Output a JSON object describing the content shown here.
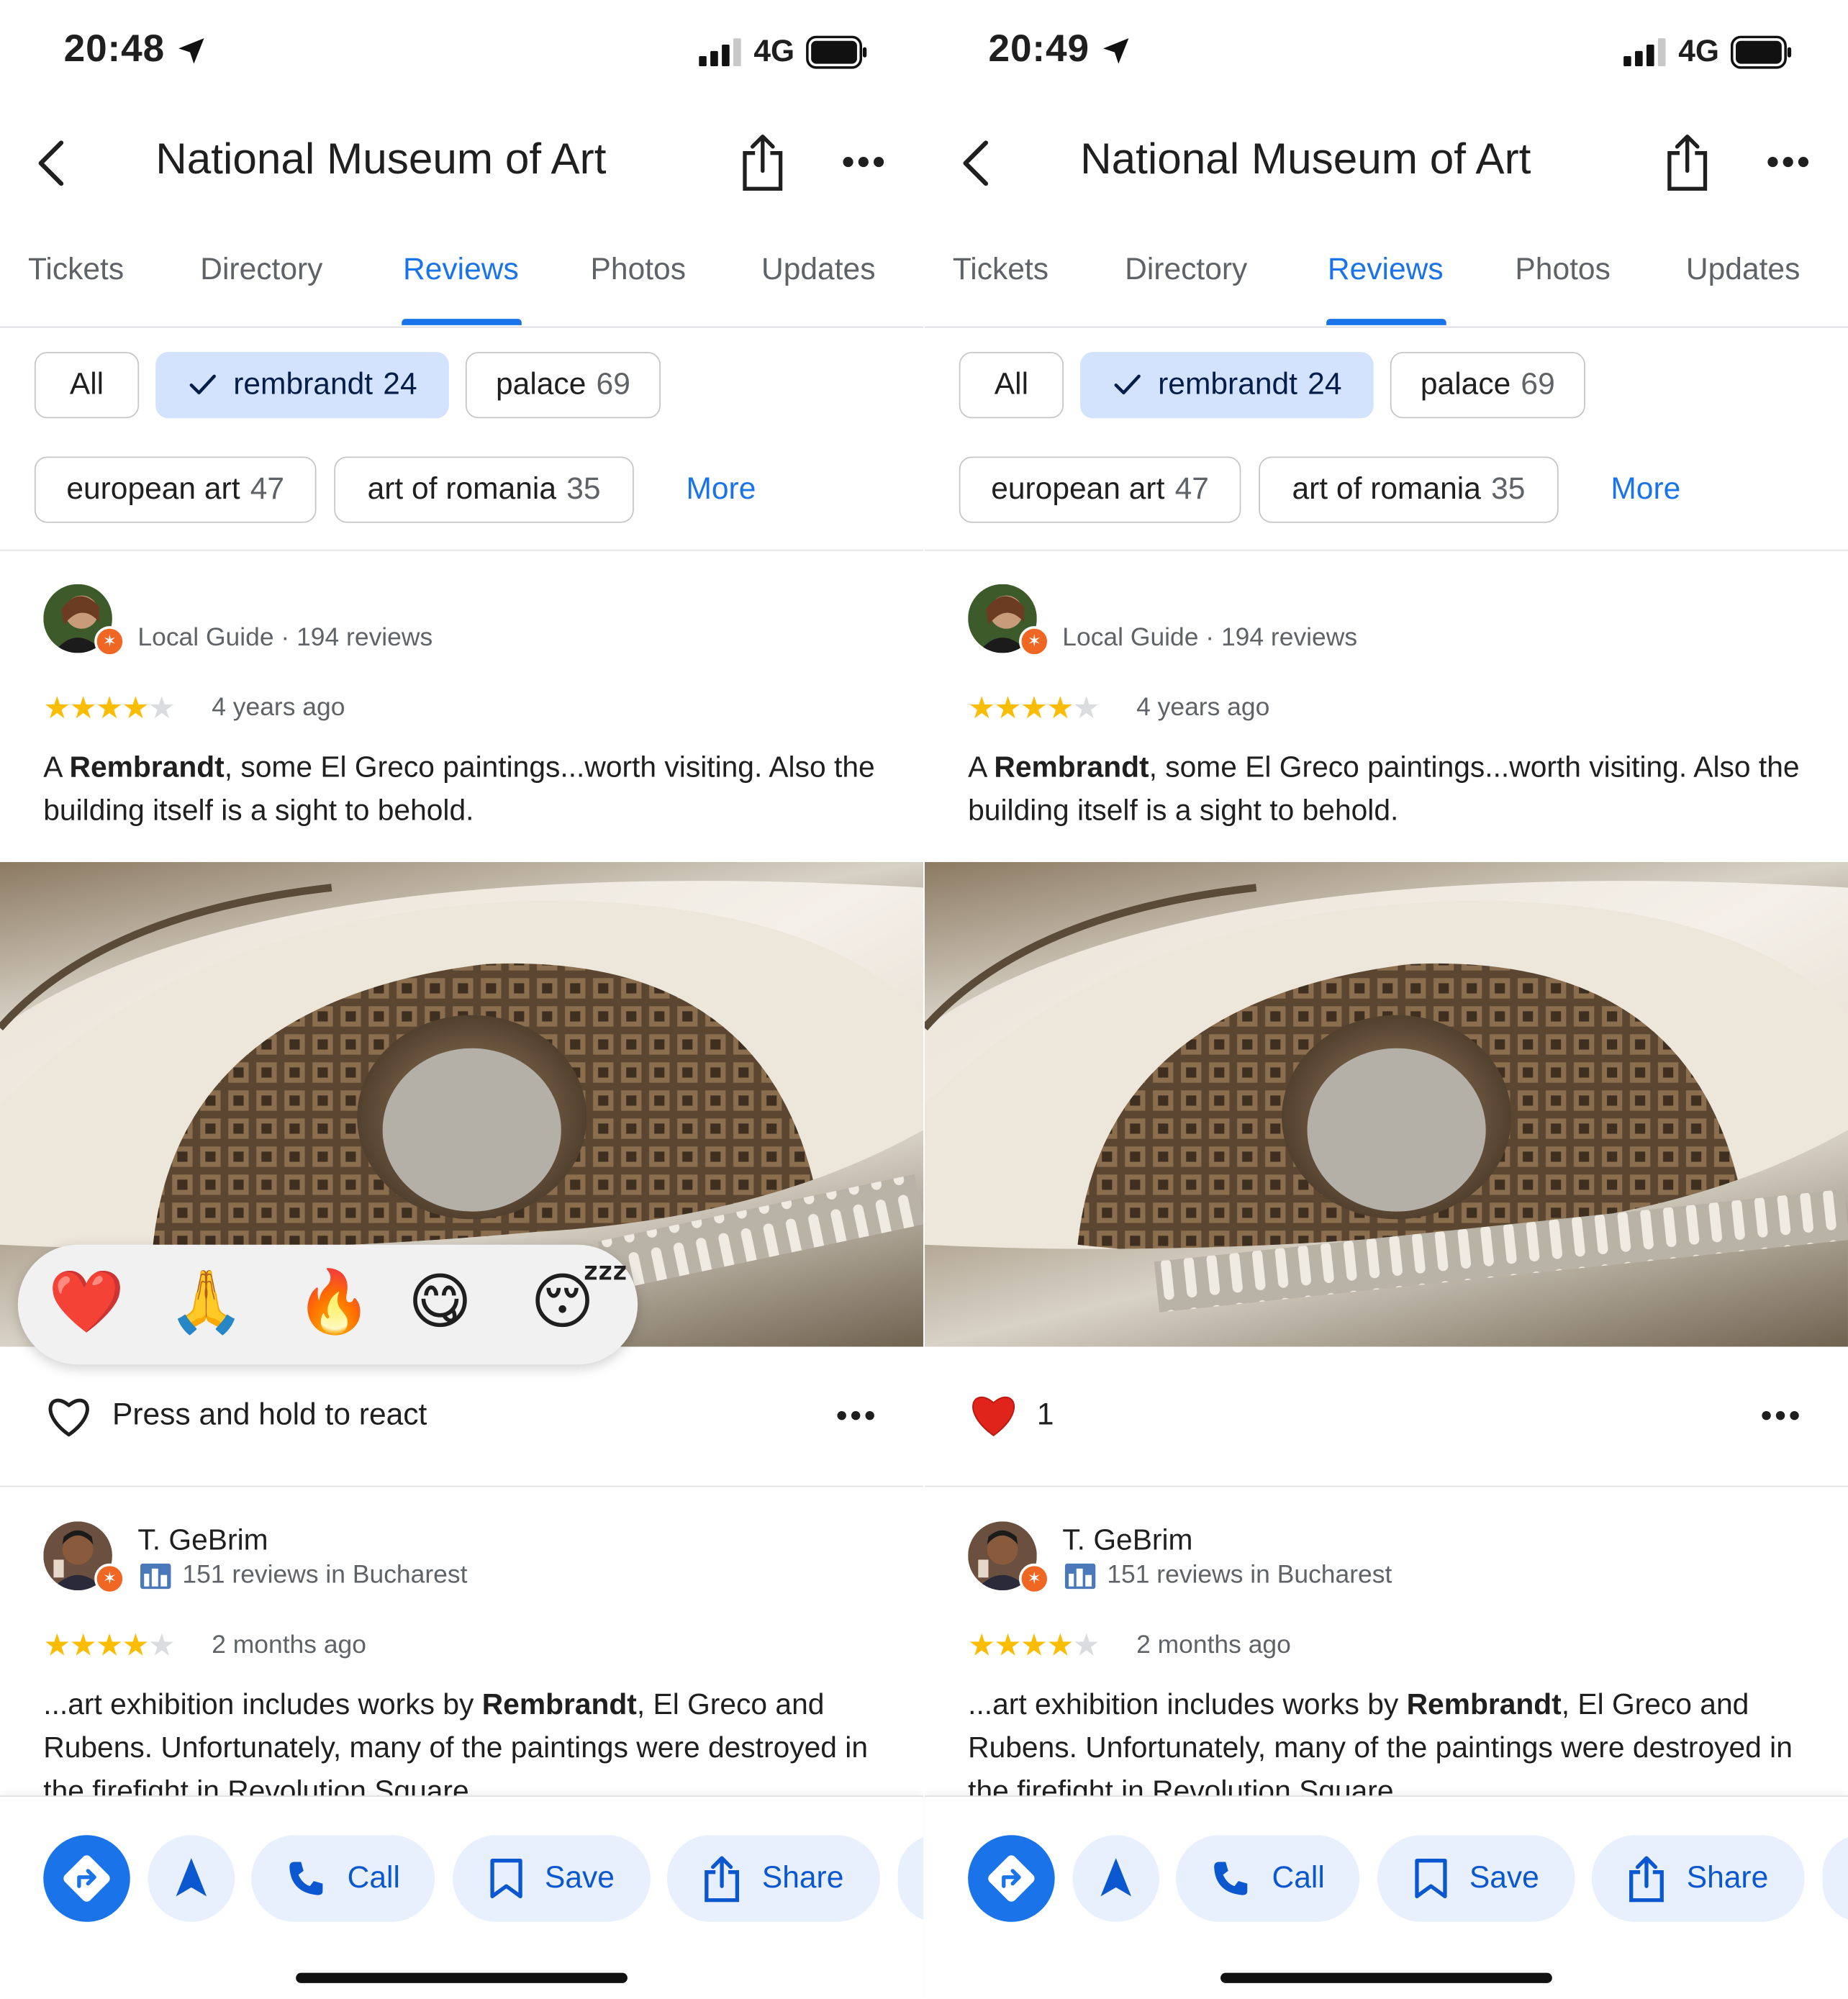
{
  "screens": [
    {
      "status": {
        "time": "20:48",
        "network": "4G"
      },
      "header": {
        "title": "National Museum of Art"
      },
      "tabs": [
        "Tickets",
        "Directory",
        "Reviews",
        "Photos",
        "Updates"
      ],
      "active_tab": "Reviews",
      "filters": [
        {
          "label": "All",
          "count": ""
        },
        {
          "label": "rembrandt",
          "count": "24",
          "selected": true
        },
        {
          "label": "palace",
          "count": "69"
        },
        {
          "label": "european art",
          "count": "47"
        },
        {
          "label": "art of romania",
          "count": "35"
        }
      ],
      "filters_more": "More",
      "review1": {
        "meta": "Local Guide · 194 reviews",
        "rating": 4,
        "time_ago": "4 years ago",
        "text_bold": "Rembrandt",
        "text_pre": "A ",
        "text_post": ", some El Greco paintings...worth visiting. Also the building itself is a sight to behold."
      },
      "reaction_emojis": [
        "❤️",
        "🙏",
        "🔥",
        "😋",
        "😴"
      ],
      "reaction_label": "Press and hold to react",
      "review2": {
        "name": "T. GeBrim",
        "meta": "151 reviews in Bucharest",
        "rating": 4,
        "time_ago": "2 months ago",
        "text_pre": "...art exhibition includes works by ",
        "text_bold": "Rembrandt",
        "text_post": ", El Greco and Rubens. Unfortunately, many of the paintings were destroyed in the firefight in Revolution Square"
      },
      "actions": {
        "call": "Call",
        "save": "Save",
        "share": "Share"
      }
    },
    {
      "status": {
        "time": "20:49",
        "network": "4G"
      },
      "header": {
        "title": "National Museum of Art"
      },
      "tabs": [
        "Tickets",
        "Directory",
        "Reviews",
        "Photos",
        "Updates"
      ],
      "active_tab": "Reviews",
      "filters": [
        {
          "label": "All",
          "count": ""
        },
        {
          "label": "rembrandt",
          "count": "24",
          "selected": true
        },
        {
          "label": "palace",
          "count": "69"
        },
        {
          "label": "european art",
          "count": "47"
        },
        {
          "label": "art of romania",
          "count": "35"
        }
      ],
      "filters_more": "More",
      "review1": {
        "meta": "Local Guide · 194 reviews",
        "rating": 4,
        "time_ago": "4 years ago",
        "text_bold": "Rembrandt",
        "text_pre": "A ",
        "text_post": ", some El Greco paintings...worth visiting. Also the building itself is a sight to behold."
      },
      "reaction_count": "1",
      "review2": {
        "name": "T. GeBrim",
        "meta": "151 reviews in Bucharest",
        "rating": 4,
        "time_ago": "2 months ago",
        "text_pre": "...art exhibition includes works by ",
        "text_bold": "Rembrandt",
        "text_post": ", El Greco and Rubens. Unfortunately, many of the paintings were destroyed in the firefight in Revolution Square"
      },
      "actions": {
        "call": "Call",
        "save": "Save",
        "share": "Share"
      }
    }
  ],
  "colors": {
    "accent": "#1a73e8",
    "chip_selected": "#d3e3fd",
    "star": "#fbbc04",
    "guide_badge": "#f06724"
  }
}
